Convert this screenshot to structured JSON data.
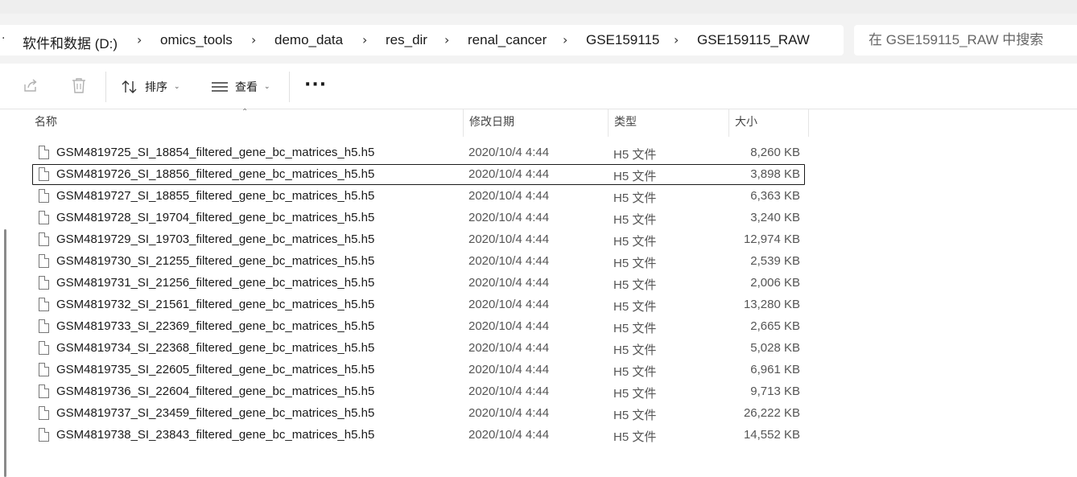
{
  "breadcrumb": {
    "items": [
      "软件和数据 (D:)",
      "omics_tools",
      "demo_data",
      "res_dir",
      "renal_cancer",
      "GSE159115",
      "GSE159115_RAW"
    ],
    "separator": "›",
    "overflow": "·"
  },
  "search": {
    "placeholder": "在 GSE159115_RAW 中搜索"
  },
  "toolbar": {
    "share_icon": "share-icon",
    "delete_icon": "delete-icon",
    "sort_label": "排序",
    "view_label": "查看",
    "more_label": "···"
  },
  "columns": {
    "name": "名称",
    "date": "修改日期",
    "type": "类型",
    "size": "大小"
  },
  "files": [
    {
      "name": "GSM4819725_SI_18854_filtered_gene_bc_matrices_h5.h5",
      "date": "2020/10/4 4:44",
      "type": "H5 文件",
      "size": "8,260 KB"
    },
    {
      "name": "GSM4819726_SI_18856_filtered_gene_bc_matrices_h5.h5",
      "date": "2020/10/4 4:44",
      "type": "H5 文件",
      "size": "3,898 KB"
    },
    {
      "name": "GSM4819727_SI_18855_filtered_gene_bc_matrices_h5.h5",
      "date": "2020/10/4 4:44",
      "type": "H5 文件",
      "size": "6,363 KB"
    },
    {
      "name": "GSM4819728_SI_19704_filtered_gene_bc_matrices_h5.h5",
      "date": "2020/10/4 4:44",
      "type": "H5 文件",
      "size": "3,240 KB"
    },
    {
      "name": "GSM4819729_SI_19703_filtered_gene_bc_matrices_h5.h5",
      "date": "2020/10/4 4:44",
      "type": "H5 文件",
      "size": "12,974 KB"
    },
    {
      "name": "GSM4819730_SI_21255_filtered_gene_bc_matrices_h5.h5",
      "date": "2020/10/4 4:44",
      "type": "H5 文件",
      "size": "2,539 KB"
    },
    {
      "name": "GSM4819731_SI_21256_filtered_gene_bc_matrices_h5.h5",
      "date": "2020/10/4 4:44",
      "type": "H5 文件",
      "size": "2,006 KB"
    },
    {
      "name": "GSM4819732_SI_21561_filtered_gene_bc_matrices_h5.h5",
      "date": "2020/10/4 4:44",
      "type": "H5 文件",
      "size": "13,280 KB"
    },
    {
      "name": "GSM4819733_SI_22369_filtered_gene_bc_matrices_h5.h5",
      "date": "2020/10/4 4:44",
      "type": "H5 文件",
      "size": "2,665 KB"
    },
    {
      "name": "GSM4819734_SI_22368_filtered_gene_bc_matrices_h5.h5",
      "date": "2020/10/4 4:44",
      "type": "H5 文件",
      "size": "5,028 KB"
    },
    {
      "name": "GSM4819735_SI_22605_filtered_gene_bc_matrices_h5.h5",
      "date": "2020/10/4 4:44",
      "type": "H5 文件",
      "size": "6,961 KB"
    },
    {
      "name": "GSM4819736_SI_22604_filtered_gene_bc_matrices_h5.h5",
      "date": "2020/10/4 4:44",
      "type": "H5 文件",
      "size": "9,713 KB"
    },
    {
      "name": "GSM4819737_SI_23459_filtered_gene_bc_matrices_h5.h5",
      "date": "2020/10/4 4:44",
      "type": "H5 文件",
      "size": "26,222 KB"
    },
    {
      "name": "GSM4819738_SI_23843_filtered_gene_bc_matrices_h5.h5",
      "date": "2020/10/4 4:44",
      "type": "H5 文件",
      "size": "14,552 KB"
    }
  ],
  "focused_file_index": 1
}
